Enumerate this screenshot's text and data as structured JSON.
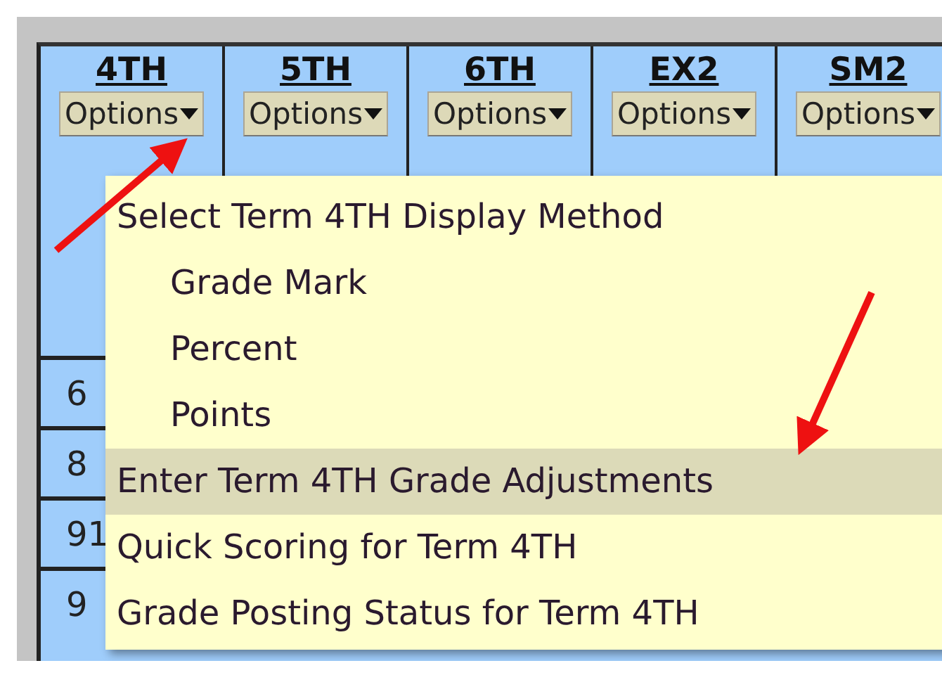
{
  "columns": [
    {
      "term": "4TH",
      "button": "Options"
    },
    {
      "term": "5TH",
      "button": "Options"
    },
    {
      "term": "6TH",
      "button": "Options"
    },
    {
      "term": "EX2",
      "button": "Options"
    },
    {
      "term": "SM2",
      "button": "Options"
    }
  ],
  "rows": [
    {
      "column_1": "6"
    },
    {
      "column_1": "8"
    },
    {
      "column_1": "91"
    },
    {
      "column_1": "9"
    }
  ],
  "menu": {
    "items": [
      {
        "kind": "header",
        "label": "Select Term 4TH Display Method",
        "selected": false
      },
      {
        "kind": "option",
        "label": "Grade Mark",
        "selected": false
      },
      {
        "kind": "option",
        "label": "Percent",
        "selected": false
      },
      {
        "kind": "option",
        "label": "Points",
        "selected": false
      },
      {
        "kind": "header",
        "label": "Enter Term 4TH Grade Adjustments",
        "selected": true
      },
      {
        "kind": "header",
        "label": "Quick Scoring for Term 4TH",
        "selected": false
      },
      {
        "kind": "header",
        "label": "Grade Posting Status for Term 4TH",
        "selected": false
      }
    ]
  }
}
